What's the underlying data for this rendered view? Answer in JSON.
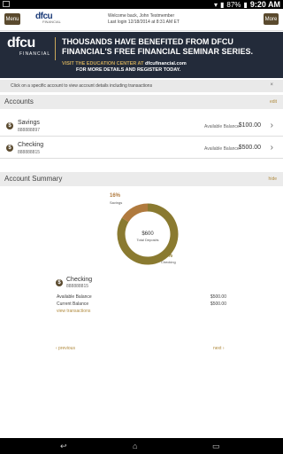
{
  "status_bar": {
    "battery": "87%",
    "time": "9:20 AM"
  },
  "header": {
    "menu_label": "Menu",
    "more_label": "More",
    "logo_name": "dfcu",
    "logo_sub": "FINANCIAL",
    "welcome": "Welcome back, John Testmember",
    "last_login": "Last login 12/18/2014 at 8:31 AM ET"
  },
  "banner": {
    "logo": "dfcu",
    "logo_sub": "FINANCIAL",
    "headline1": "THOUSANDS HAVE BENEFITED FROM DFCU",
    "headline2": "FINANCIAL'S FREE FINANCIAL SEMINAR SERIES.",
    "cta1": "VISIT THE EDUCATION CENTER AT",
    "cta_url": "dfcufinancial.com",
    "cta2": "FOR MORE DETAILS AND REGISTER TODAY."
  },
  "info_bar": {
    "text": "Click on a specific account to view account details including transactions",
    "close": "×"
  },
  "accounts_section": {
    "title": "Accounts",
    "edit_label": "edit",
    "items": [
      {
        "name": "Savings",
        "number": "888888897",
        "balance_label": "Available Balance",
        "amount": "$100.00"
      },
      {
        "name": "Checking",
        "number": "888888815",
        "balance_label": "Available Balance",
        "amount": "$500.00"
      }
    ]
  },
  "summary_section": {
    "title": "Account Summary",
    "hide_label": "hide",
    "donut": {
      "total_amount": "$600",
      "total_label": "Total Deposits",
      "slices": [
        {
          "name": "Savings",
          "percent_label": "16%",
          "value": 16,
          "color": "#b07a3e"
        },
        {
          "name": "Checking",
          "percent_label": "84%",
          "value": 84,
          "color": "#8a7a30"
        }
      ]
    },
    "detail": {
      "name": "Checking",
      "number": "888888815",
      "available_label": "Available Balance",
      "available_value": "$500.00",
      "current_label": "Current Balance",
      "current_value": "$500.00",
      "view_link": "view transactions"
    },
    "pager": {
      "previous": "‹  previous",
      "next": "next  ›"
    }
  },
  "colors": {
    "accent": "#b08a3e",
    "brand_dark": "#5a4a2e",
    "banner_bg": "#232b3a"
  }
}
